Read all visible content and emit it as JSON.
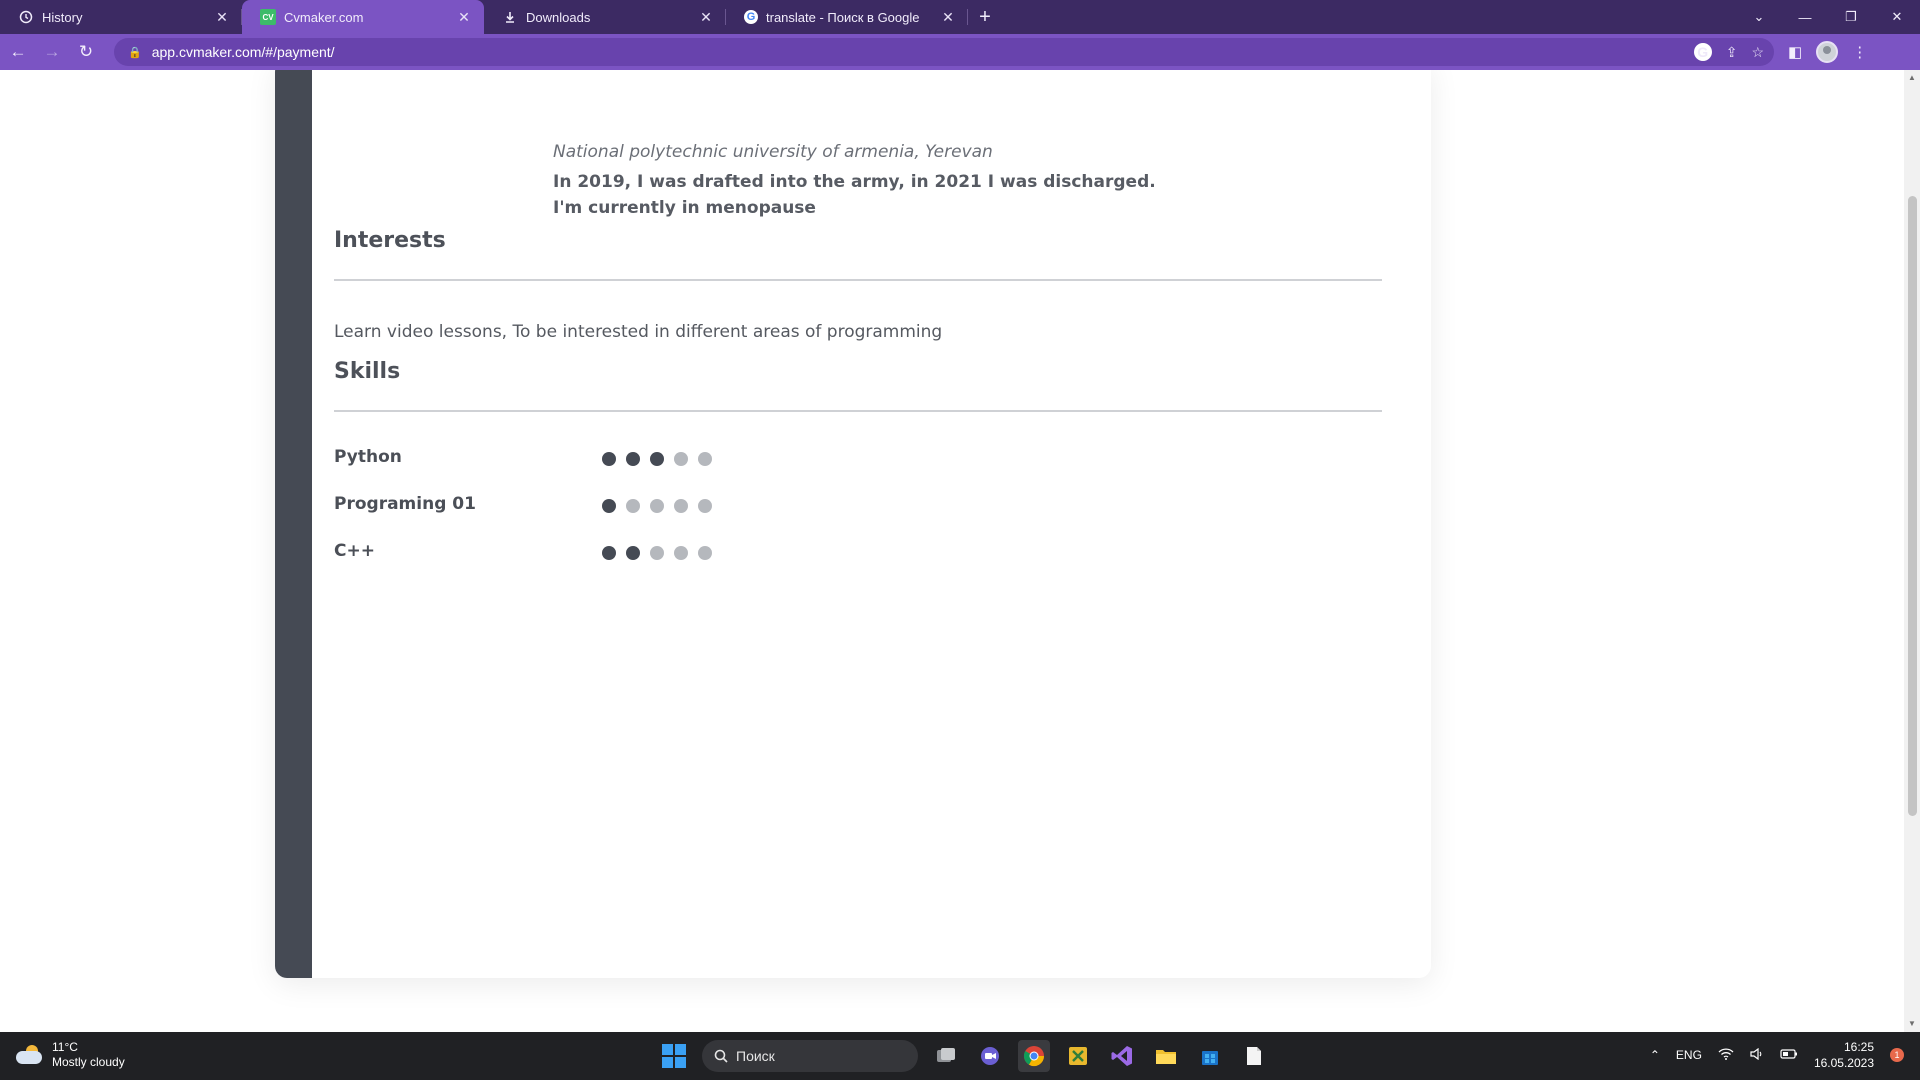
{
  "browser": {
    "tabs": [
      {
        "label": "History",
        "icon": "history-icon"
      },
      {
        "label": "Cvmaker.com",
        "icon": "cvmaker-icon",
        "favicon_text": "CV",
        "active": true
      },
      {
        "label": "Downloads",
        "icon": "download-icon"
      },
      {
        "label": "translate - Поиск в Google",
        "icon": "google-icon",
        "favicon_text": "G"
      }
    ],
    "url": "app.cvmaker.com/#/payment/",
    "accent": "#7b54c3",
    "tabbar_color": "#3c2a63"
  },
  "resume": {
    "education": {
      "school": "National polytechnic university of armenia, Yerevan",
      "description_line1": "In 2019, I was drafted into the army, in 2021 I was discharged.",
      "description_line2": "I'm currently in menopause"
    },
    "interests": {
      "heading": "Interests",
      "text": "Learn video lessons, To be interested in different areas of programming"
    },
    "skills": {
      "heading": "Skills",
      "items": [
        {
          "name": "Python",
          "level": 3,
          "max": 5
        },
        {
          "name": "Programing 01",
          "level": 1,
          "max": 5
        },
        {
          "name": "C++",
          "level": 2,
          "max": 5
        }
      ]
    },
    "sidebar_color": "#454a54"
  },
  "taskbar": {
    "weather_temp": "11°C",
    "weather_desc": "Mostly cloudy",
    "search_placeholder": "Поиск",
    "language": "ENG",
    "time": "16:25",
    "date": "16.05.2023",
    "notification_count": "1"
  }
}
